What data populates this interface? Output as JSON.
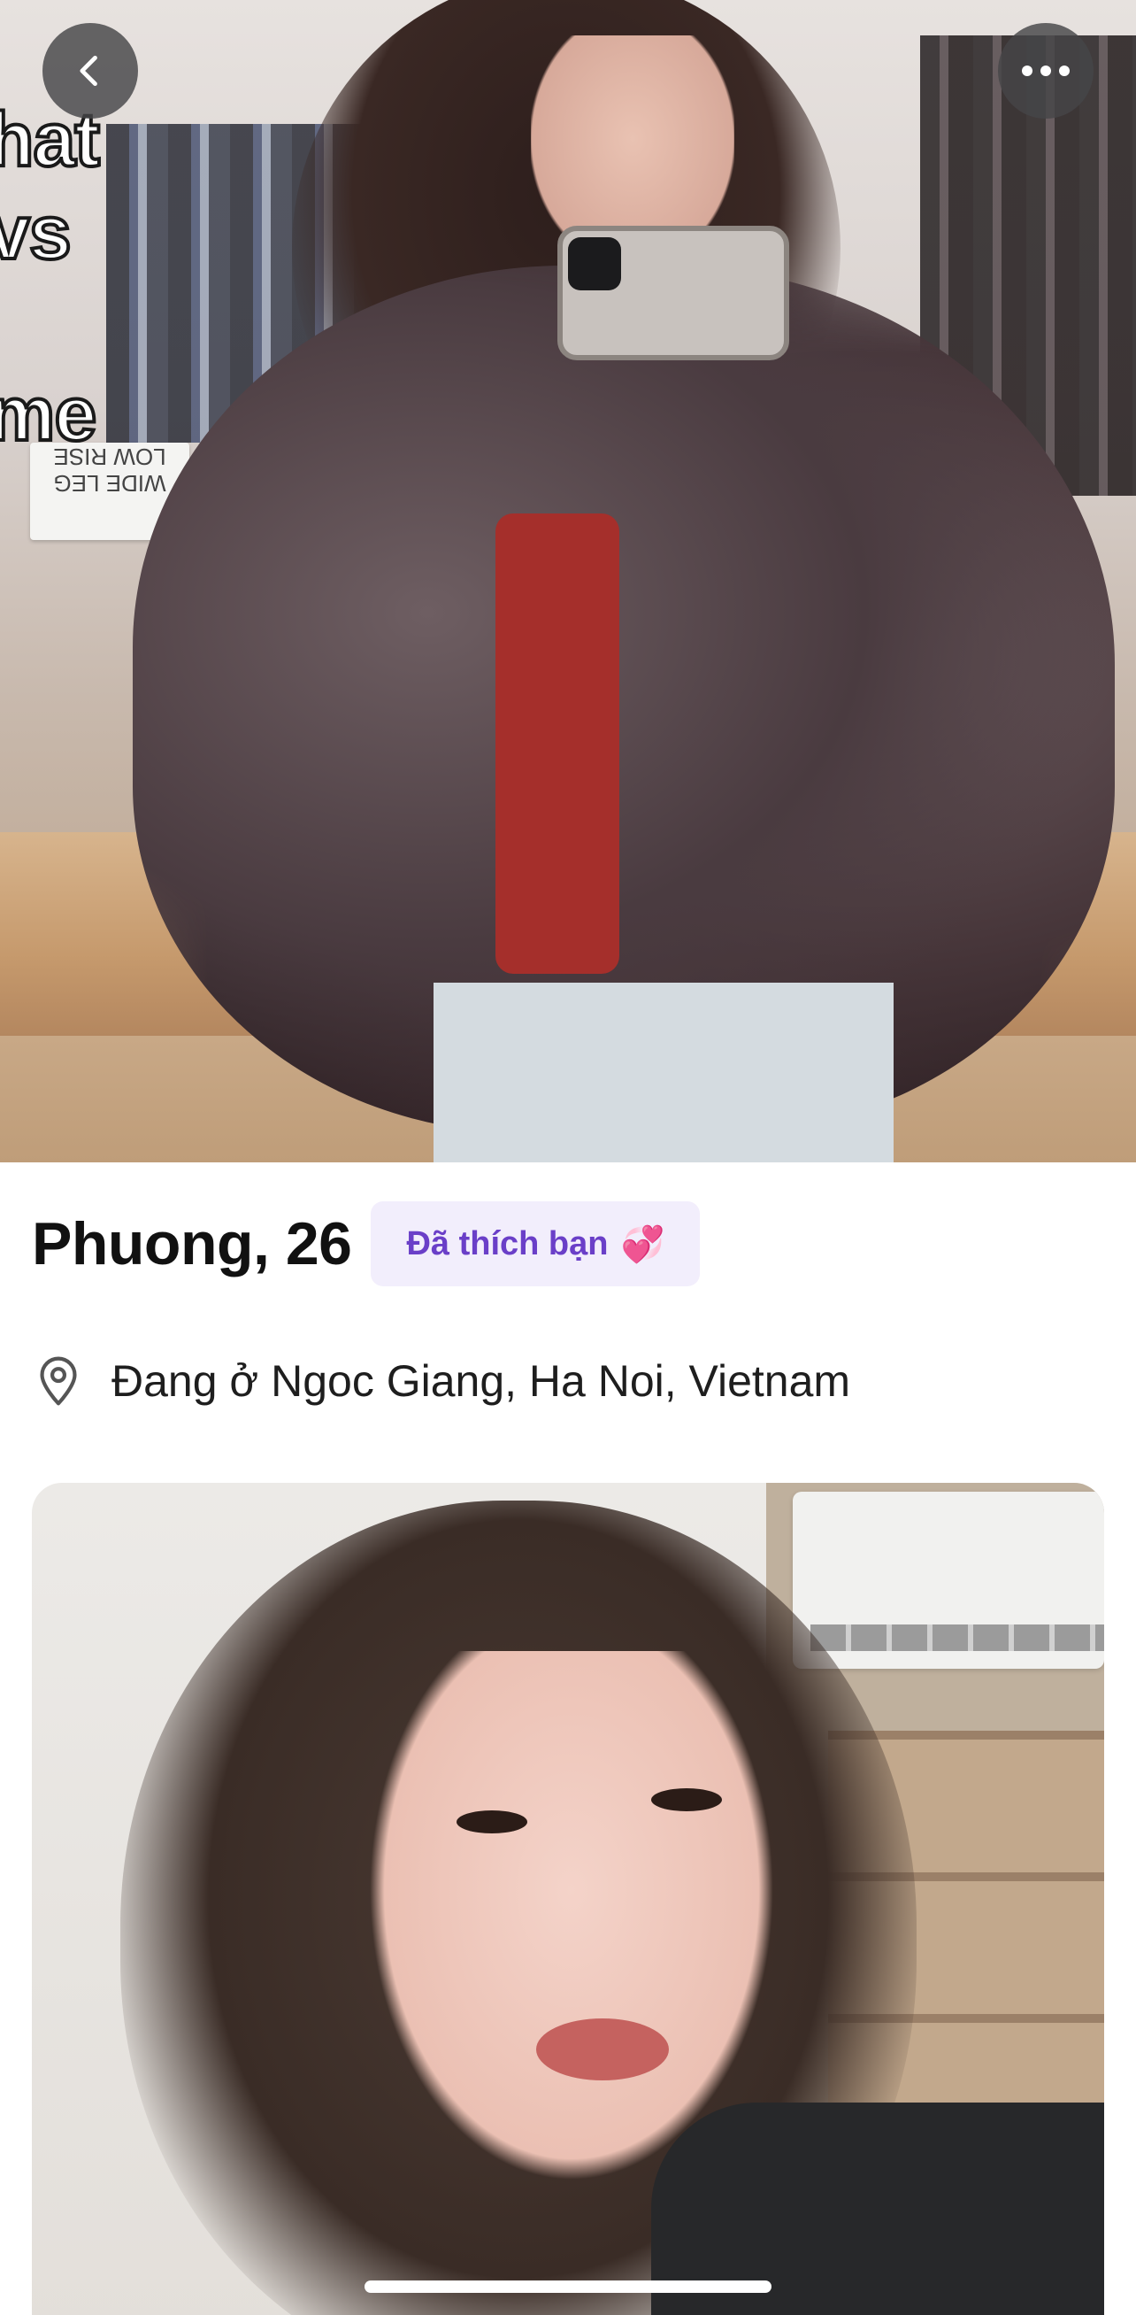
{
  "top_photo": {
    "overlay_text_lines": [
      "hat",
      "vs",
      "me"
    ],
    "sign_text": [
      "WIDE LEG",
      "LOW RISE"
    ]
  },
  "buttons": {
    "back_icon": "chevron-left-icon",
    "more_icon": "more-horizontal-icon"
  },
  "profile": {
    "name_age": "Phuong, 26",
    "liked_badge": "Đã thích bạn",
    "liked_badge_icon": "💞",
    "location_icon": "map-pin-icon",
    "location": "Đang ở Ngoc Giang, Ha Noi, Vietnam"
  },
  "colors": {
    "badge_bg": "#f2eefc",
    "badge_text": "#6a3fc8",
    "overlay_button_bg": "#464648"
  }
}
